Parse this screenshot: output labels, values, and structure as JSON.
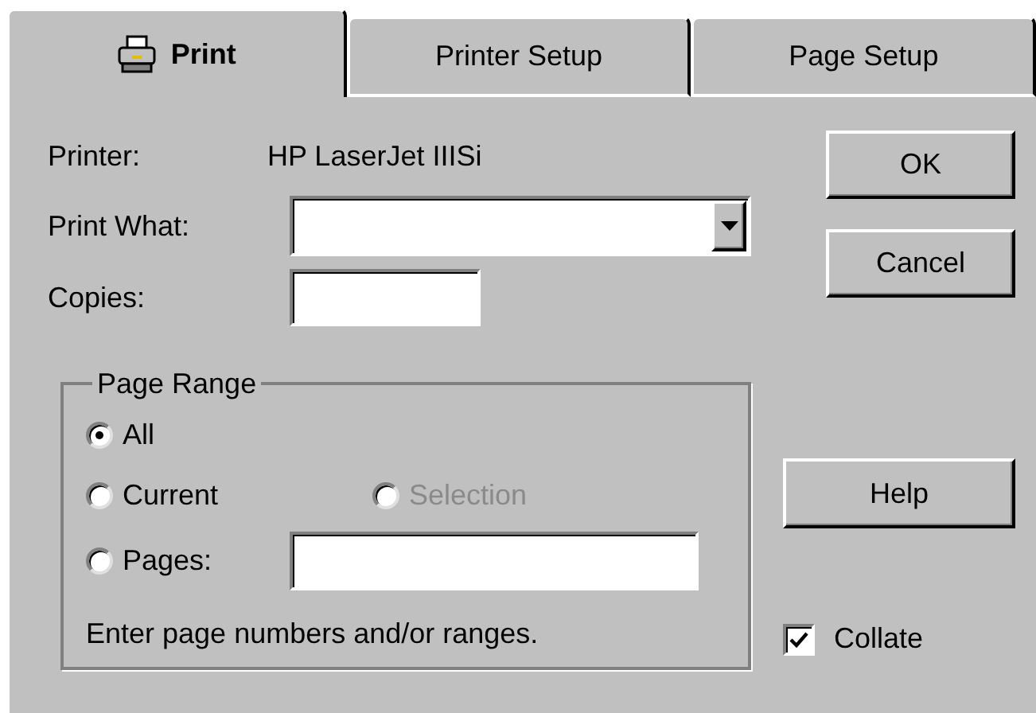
{
  "tabs": [
    {
      "label": "Print",
      "selected": true
    },
    {
      "label": "Printer Setup",
      "selected": false
    },
    {
      "label": "Page Setup",
      "selected": false
    }
  ],
  "printer": {
    "label": "Printer:",
    "value": "HP LaserJet IIISi"
  },
  "print_what": {
    "label": "Print What:"
  },
  "copies": {
    "label": "Copies:"
  },
  "page_range": {
    "title": "Page Range",
    "options": [
      {
        "label": "All",
        "selected": true,
        "disabled": false
      },
      {
        "label": "Current",
        "selected": false,
        "disabled": false
      },
      {
        "label": "Selection",
        "selected": false,
        "disabled": true
      },
      {
        "label": "Pages:",
        "selected": false,
        "disabled": false
      }
    ],
    "hint": "Enter page numbers and/or ranges."
  },
  "buttons": [
    "OK",
    "Cancel",
    "Help"
  ],
  "collate": {
    "label": "Collate",
    "checked": true
  }
}
